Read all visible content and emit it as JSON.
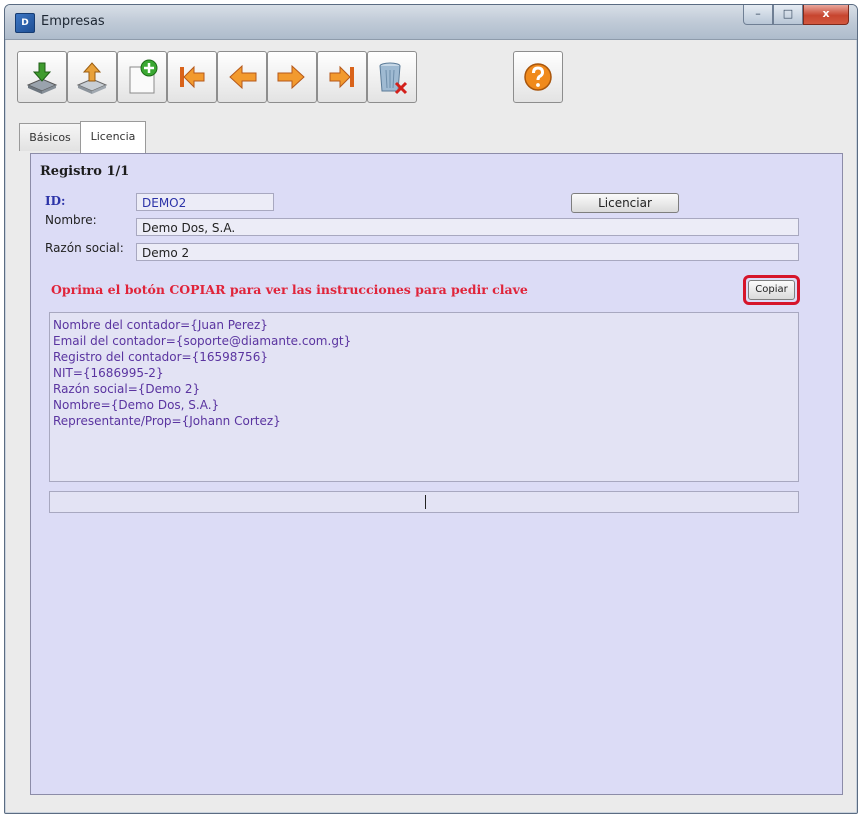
{
  "window": {
    "title": "Empresas",
    "app_icon_text": "D",
    "controls": {
      "minimize": "–",
      "maximize": "□",
      "close": "x"
    }
  },
  "toolbar": {
    "buttons": [
      {
        "name": "download-icon"
      },
      {
        "name": "upload-icon"
      },
      {
        "name": "new-record-icon"
      },
      {
        "name": "first-record-icon"
      },
      {
        "name": "previous-record-icon"
      },
      {
        "name": "next-record-icon"
      },
      {
        "name": "last-record-icon"
      },
      {
        "name": "delete-icon"
      },
      {
        "name": "help-icon"
      }
    ]
  },
  "tabs": [
    {
      "label": "Básicos",
      "active": false
    },
    {
      "label": "Licencia",
      "active": true
    }
  ],
  "form": {
    "record_title": "Registro 1/1",
    "id_label": "ID:",
    "id_value": "DEMO2",
    "licenciar_button": "Licenciar",
    "nombre_label": "Nombre:",
    "nombre_value": "Demo Dos, S.A.",
    "razon_label": "Razón social:",
    "razon_value": "Demo 2",
    "instruction": "Oprima el botón COPIAR para ver las instrucciones  para pedir clave",
    "copiar_button": "Copiar",
    "memo_lines": [
      "Nombre del contador={Juan Perez}",
      "Email del contador={soporte@diamante.com.gt}",
      "Registro del contador={16598756}",
      "NIT={1686995-2}",
      "Razón social={Demo 2}",
      "Nombre={Demo Dos, S.A.}",
      "Representante/Prop={Johann Cortez}"
    ],
    "bottom_field_value": ""
  },
  "colors": {
    "panel_bg": "#dcdcf6",
    "instruction_red": "#e0243a",
    "id_blue": "#2c33a8",
    "copy_highlight": "#d6152b"
  }
}
